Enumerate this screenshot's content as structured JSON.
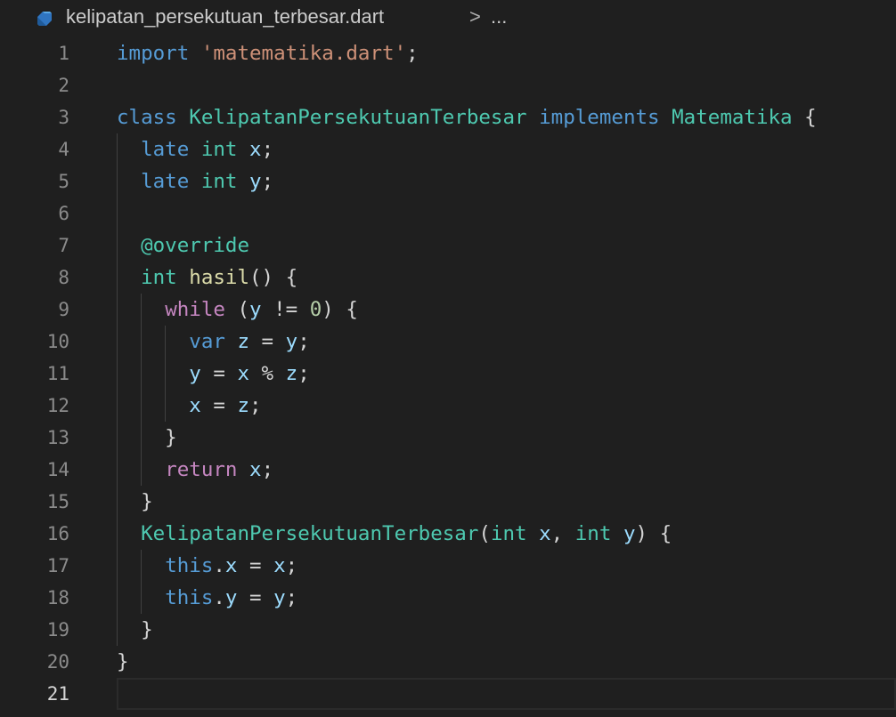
{
  "breadcrumb": {
    "file_name": "kelipatan_persekutuan_terbesar.dart",
    "separator": ">",
    "more": "...",
    "file_icon": "dart-file-icon"
  },
  "editor": {
    "active_line": 21,
    "line_numbers": [
      "1",
      "2",
      "3",
      "4",
      "5",
      "6",
      "7",
      "8",
      "9",
      "10",
      "11",
      "12",
      "13",
      "14",
      "15",
      "16",
      "17",
      "18",
      "19",
      "20",
      "21"
    ],
    "lines": [
      [
        {
          "t": "import",
          "c": "kw-blue"
        },
        {
          "t": " ",
          "c": "punc"
        },
        {
          "t": "'matematika.dart'",
          "c": "str"
        },
        {
          "t": ";",
          "c": "punc"
        }
      ],
      [],
      [
        {
          "t": "class",
          "c": "kw-blue"
        },
        {
          "t": " ",
          "c": "punc"
        },
        {
          "t": "KelipatanPersekutuanTerbesar",
          "c": "type"
        },
        {
          "t": " ",
          "c": "punc"
        },
        {
          "t": "implements",
          "c": "kw-blue"
        },
        {
          "t": " ",
          "c": "punc"
        },
        {
          "t": "Matematika",
          "c": "type"
        },
        {
          "t": " {",
          "c": "punc"
        }
      ],
      [
        {
          "t": "  ",
          "c": "punc"
        },
        {
          "t": "late",
          "c": "kw-blue"
        },
        {
          "t": " ",
          "c": "punc"
        },
        {
          "t": "int",
          "c": "type"
        },
        {
          "t": " ",
          "c": "punc"
        },
        {
          "t": "x",
          "c": "var"
        },
        {
          "t": ";",
          "c": "punc"
        }
      ],
      [
        {
          "t": "  ",
          "c": "punc"
        },
        {
          "t": "late",
          "c": "kw-blue"
        },
        {
          "t": " ",
          "c": "punc"
        },
        {
          "t": "int",
          "c": "type"
        },
        {
          "t": " ",
          "c": "punc"
        },
        {
          "t": "y",
          "c": "var"
        },
        {
          "t": ";",
          "c": "punc"
        }
      ],
      [],
      [
        {
          "t": "  ",
          "c": "punc"
        },
        {
          "t": "@override",
          "c": "type"
        }
      ],
      [
        {
          "t": "  ",
          "c": "punc"
        },
        {
          "t": "int",
          "c": "type"
        },
        {
          "t": " ",
          "c": "punc"
        },
        {
          "t": "hasil",
          "c": "fn"
        },
        {
          "t": "() {",
          "c": "punc"
        }
      ],
      [
        {
          "t": "    ",
          "c": "punc"
        },
        {
          "t": "while",
          "c": "kw-pink"
        },
        {
          "t": " (",
          "c": "punc"
        },
        {
          "t": "y",
          "c": "var"
        },
        {
          "t": " != ",
          "c": "punc"
        },
        {
          "t": "0",
          "c": "num"
        },
        {
          "t": ") {",
          "c": "punc"
        }
      ],
      [
        {
          "t": "      ",
          "c": "punc"
        },
        {
          "t": "var",
          "c": "kw-blue"
        },
        {
          "t": " ",
          "c": "punc"
        },
        {
          "t": "z",
          "c": "var"
        },
        {
          "t": " = ",
          "c": "punc"
        },
        {
          "t": "y",
          "c": "var"
        },
        {
          "t": ";",
          "c": "punc"
        }
      ],
      [
        {
          "t": "      ",
          "c": "punc"
        },
        {
          "t": "y",
          "c": "var"
        },
        {
          "t": " = ",
          "c": "punc"
        },
        {
          "t": "x",
          "c": "var"
        },
        {
          "t": " % ",
          "c": "punc"
        },
        {
          "t": "z",
          "c": "var"
        },
        {
          "t": ";",
          "c": "punc"
        }
      ],
      [
        {
          "t": "      ",
          "c": "punc"
        },
        {
          "t": "x",
          "c": "var"
        },
        {
          "t": " = ",
          "c": "punc"
        },
        {
          "t": "z",
          "c": "var"
        },
        {
          "t": ";",
          "c": "punc"
        }
      ],
      [
        {
          "t": "    }",
          "c": "punc"
        }
      ],
      [
        {
          "t": "    ",
          "c": "punc"
        },
        {
          "t": "return",
          "c": "kw-pink"
        },
        {
          "t": " ",
          "c": "punc"
        },
        {
          "t": "x",
          "c": "var"
        },
        {
          "t": ";",
          "c": "punc"
        }
      ],
      [
        {
          "t": "  }",
          "c": "punc"
        }
      ],
      [
        {
          "t": "  ",
          "c": "punc"
        },
        {
          "t": "KelipatanPersekutuanTerbesar",
          "c": "type"
        },
        {
          "t": "(",
          "c": "punc"
        },
        {
          "t": "int",
          "c": "type"
        },
        {
          "t": " ",
          "c": "punc"
        },
        {
          "t": "x",
          "c": "var"
        },
        {
          "t": ", ",
          "c": "punc"
        },
        {
          "t": "int",
          "c": "type"
        },
        {
          "t": " ",
          "c": "punc"
        },
        {
          "t": "y",
          "c": "var"
        },
        {
          "t": ") {",
          "c": "punc"
        }
      ],
      [
        {
          "t": "    ",
          "c": "punc"
        },
        {
          "t": "this",
          "c": "kw-blue"
        },
        {
          "t": ".",
          "c": "punc"
        },
        {
          "t": "x",
          "c": "var"
        },
        {
          "t": " = ",
          "c": "punc"
        },
        {
          "t": "x",
          "c": "var"
        },
        {
          "t": ";",
          "c": "punc"
        }
      ],
      [
        {
          "t": "    ",
          "c": "punc"
        },
        {
          "t": "this",
          "c": "kw-blue"
        },
        {
          "t": ".",
          "c": "punc"
        },
        {
          "t": "y",
          "c": "var"
        },
        {
          "t": " = ",
          "c": "punc"
        },
        {
          "t": "y",
          "c": "var"
        },
        {
          "t": ";",
          "c": "punc"
        }
      ],
      [
        {
          "t": "  }",
          "c": "punc"
        }
      ],
      [
        {
          "t": "}",
          "c": "punc"
        }
      ],
      []
    ]
  }
}
